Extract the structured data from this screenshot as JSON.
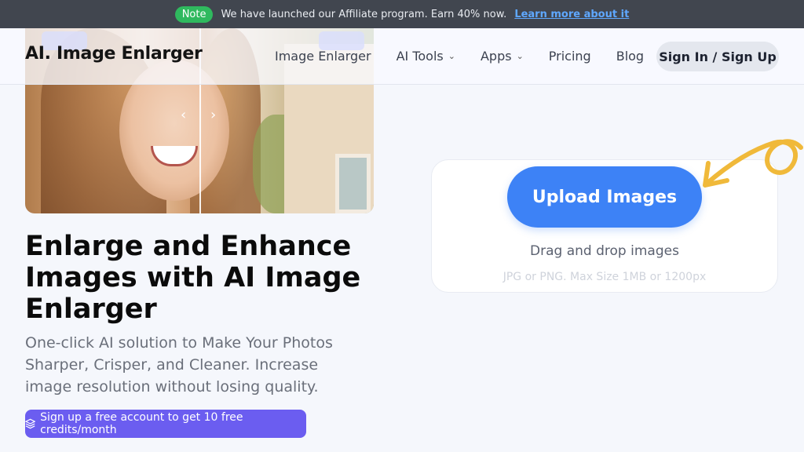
{
  "announcement": {
    "badge": "Note",
    "text": "We have launched our Affiliate program. Earn 40% now.",
    "link": "Learn more about it"
  },
  "nav": {
    "logo": "AI. Image Enlarger",
    "links": [
      "Image Enlarger",
      "AI Tools",
      "Apps",
      "Pricing",
      "Blog"
    ],
    "signin": "Sign In / Sign Up"
  },
  "hero": {
    "headline": "Enlarge and Enhance Images with AI Image Enlarger",
    "subhead": "One-click AI solution to Make Your Photos Sharper, Crisper, and Cleaner. Increase image resolution without losing quality.",
    "promo": "Sign up a free account to get 10 free credits/month"
  },
  "upload": {
    "button": "Upload Images",
    "drag": "Drag and drop images",
    "hint": "JPG or PNG. Max Size 1MB or 1200px"
  },
  "icons": {
    "slider_left": "chevron-left-icon",
    "slider_right": "chevron-right-icon",
    "nav_dropdown": "chevron-down-icon",
    "promo": "layers-icon"
  },
  "colors": {
    "accent_blue": "#3d82f6",
    "promo_purple": "#6b5df0",
    "note_green": "#2fb95e",
    "deco_yellow": "#f0b93a"
  }
}
